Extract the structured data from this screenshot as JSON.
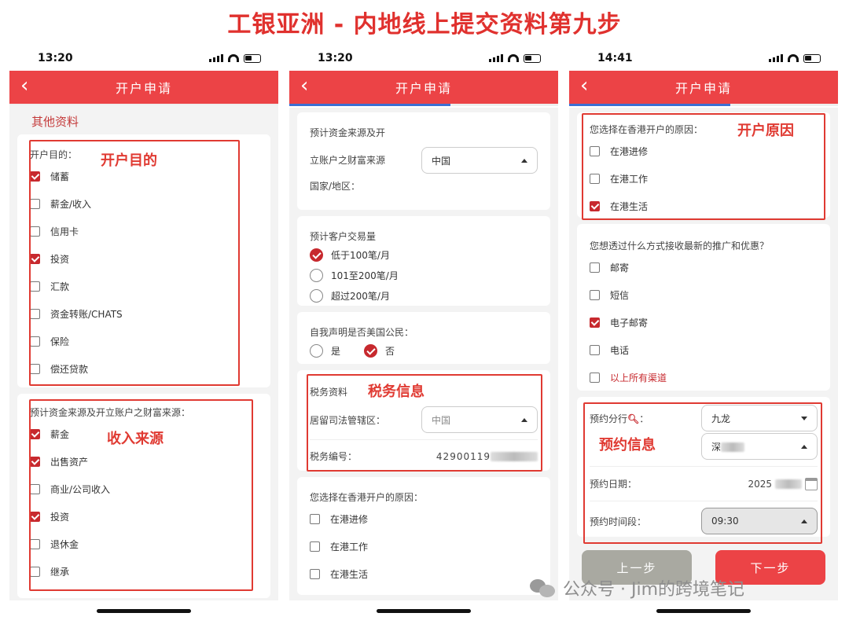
{
  "page_title": "工银亚洲 - 内地线上提交资料第九步",
  "watermark": "公众号 · Jim的跨境笔记",
  "common": {
    "nav_title": "开户申请",
    "back_icon": "chevron-left-icon"
  },
  "phone1": {
    "time": "13:20",
    "section_title": "其他资料",
    "purpose": {
      "question": "开户目的：",
      "annotation": "开户目的",
      "options": [
        {
          "label": "储蓄",
          "checked": true
        },
        {
          "label": "薪金/收入",
          "checked": false
        },
        {
          "label": "信用卡",
          "checked": false
        },
        {
          "label": "投资",
          "checked": true
        },
        {
          "label": "汇款",
          "checked": false
        },
        {
          "label": "资金转账/CHATS",
          "checked": false
        },
        {
          "label": "保险",
          "checked": false
        },
        {
          "label": "偿还贷款",
          "checked": false
        }
      ]
    },
    "wealth_source": {
      "question": "预计资金来源及开立账户之财富来源：",
      "annotation": "收入来源",
      "options": [
        {
          "label": "薪金",
          "checked": true
        },
        {
          "label": "出售资产",
          "checked": true
        },
        {
          "label": "商业/公司收入",
          "checked": false
        },
        {
          "label": "投资",
          "checked": true
        },
        {
          "label": "退休金",
          "checked": false
        },
        {
          "label": "继承",
          "checked": false
        }
      ]
    }
  },
  "phone2": {
    "time": "13:20",
    "country": {
      "line1": "预计资金来源及开",
      "line2": "立账户之财富来源",
      "line3": "国家/地区：",
      "value": "中国"
    },
    "volume": {
      "question": "预计客户交易量",
      "options": [
        {
          "label": "低于100笔/月",
          "checked": true
        },
        {
          "label": "101至200笔/月",
          "checked": false
        },
        {
          "label": "超过200笔/月",
          "checked": false
        }
      ]
    },
    "us_citizen": {
      "question": "自我声明是否美国公民：",
      "options": [
        {
          "label": "是",
          "checked": false
        },
        {
          "label": "否",
          "checked": true
        }
      ]
    },
    "tax": {
      "title": "税务资料",
      "annotation": "税务信息",
      "jurisdiction_label": "居留司法管辖区：",
      "jurisdiction_value": "中国",
      "number_label": "税务编号：",
      "number_value": "42900119"
    },
    "reason": {
      "question": "您选择在香港开户的原因：",
      "options": [
        {
          "label": "在港进修",
          "checked": false
        },
        {
          "label": "在港工作",
          "checked": false
        },
        {
          "label": "在港生活",
          "checked": false
        }
      ]
    }
  },
  "phone3": {
    "time": "14:41",
    "reason": {
      "question": "您选择在香港开户的原因：",
      "annotation": "开户原因",
      "options": [
        {
          "label": "在港进修",
          "checked": false
        },
        {
          "label": "在港工作",
          "checked": false
        },
        {
          "label": "在港生活",
          "checked": true
        }
      ]
    },
    "promo": {
      "question": "您想透过什么方式接收最新的推广和优惠？",
      "options": [
        {
          "label": "邮寄",
          "checked": false
        },
        {
          "label": "短信",
          "checked": false
        },
        {
          "label": "电子邮寄",
          "checked": true
        },
        {
          "label": "电话",
          "checked": false
        },
        {
          "label": "以上所有渠道",
          "checked": false
        }
      ]
    },
    "appointment": {
      "annotation": "预约信息",
      "branch_label": "预约分行",
      "branch_colon": "：",
      "branch_value": "九龙",
      "branch_sub_value": "深",
      "date_label": "预约日期：",
      "date_value": "2025",
      "time_label": "预约时间段：",
      "time_value": "09:30"
    },
    "prev_button": "上一步",
    "next_button": "下一步"
  }
}
